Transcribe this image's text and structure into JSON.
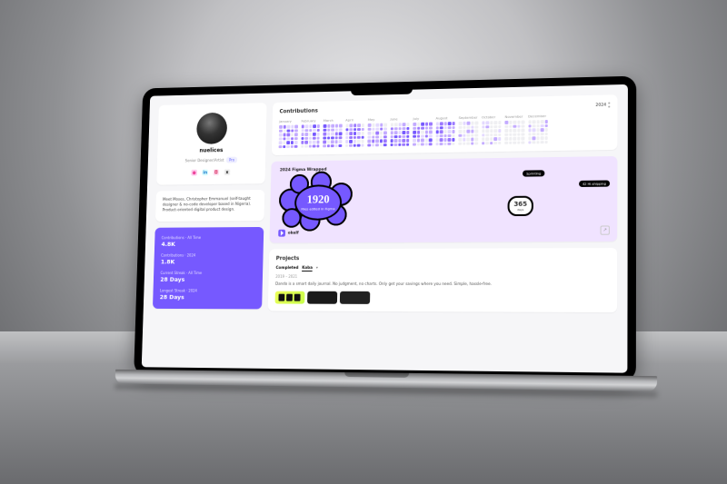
{
  "profile": {
    "username": "nuelices",
    "role": "Senior Designer/Artist",
    "pro_label": "Pro",
    "social": {
      "dribbble": "d",
      "linkedin": "in",
      "instagram": "ig",
      "x": "x"
    }
  },
  "bio": "Meet Moses, Christopher Emmanuel (self-taught designer & no-code developer based in Nigeria). Product-oriented digital product design.",
  "stats": [
    {
      "label": "Contributions · All Time",
      "value": "4.8K"
    },
    {
      "label": "Contributions · 2024",
      "value": "1.8K"
    },
    {
      "label": "Current Streak · All Time",
      "value": "28 Days"
    },
    {
      "label": "Longest Streak · 2024",
      "value": "28 Days"
    }
  ],
  "contributions": {
    "title": "Contributions",
    "year": "2024",
    "months": [
      "January",
      "February",
      "March",
      "April",
      "May",
      "June",
      "July",
      "August",
      "September",
      "October",
      "November",
      "December"
    ]
  },
  "figma_card": {
    "title": "2024 Figma Wrapped",
    "big_number": "1920",
    "big_sub": "Files edited in Figma",
    "badge_number": "365",
    "badge_sub": "days",
    "pill1": "Sprinting",
    "pill2": "42 Hi-shipping",
    "by": "okelf"
  },
  "projects": {
    "title": "Projects",
    "tag_completed": "Completed",
    "tag_name": "Koba",
    "period": "2019 – 2021",
    "desc": "Dando is a smart daily journal. No judgment, no charts. Only get your savings where you need. Simple, hassle-free."
  }
}
